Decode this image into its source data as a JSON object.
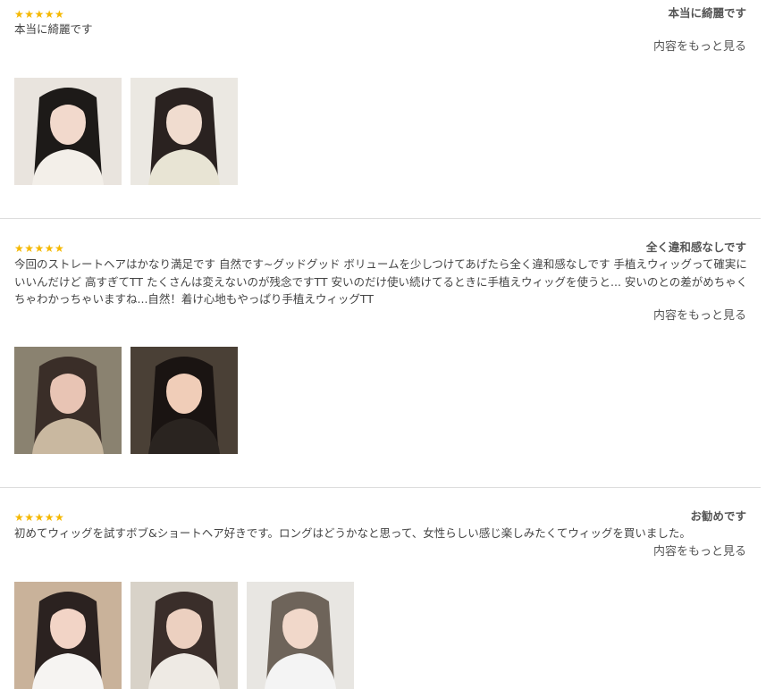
{
  "reviews": [
    {
      "stars": "★★★★★",
      "title": "本当に綺麗です",
      "body": "本当に綺麗です",
      "more_label": "内容をもっと見る",
      "photos": [
        {
          "icon": "photo-woman-long-black-hair-mirror",
          "bg": "#e9e4de",
          "hair": "#1d1a18",
          "cloth": "#f3efe9",
          "skin": "#f2d9cc"
        },
        {
          "icon": "photo-woman-cream-jacket",
          "bg": "#ebe8e2",
          "hair": "#2a2220",
          "cloth": "#e8e4d4",
          "skin": "#f0dccf"
        }
      ]
    },
    {
      "stars": "★★★★★",
      "title": "全く違和感なしです",
      "body": "今回のストレートヘアはかなり満足です 自然です~グッドグッド ボリュームを少しつけてあげたら全く違和感なしです 手植えウィッグって確実にいいんだけど 高すぎてTT たくさんは変えないのが残念ですTT 安いのだけ使い続けてるときに手植えウィッグを使うと... 安いのとの差がめちゃくちゃわかっちゃいますね...自然！着け心地もやっぱり手植えウィッグTT",
      "more_label": "内容をもっと見る",
      "photos": [
        {
          "icon": "photo-person-lying-short-hair",
          "bg": "#8a8270",
          "hair": "#3a2e28",
          "cloth": "#c9b8a0",
          "skin": "#e8c4b4"
        },
        {
          "icon": "photo-woman-long-hair-dark-room",
          "bg": "#4a4036",
          "hair": "#1a1412",
          "cloth": "#2a2420",
          "skin": "#f0cdb8"
        }
      ]
    },
    {
      "stars": "★★★★★",
      "title": "お勧めです",
      "body": "初めてウィッグを試すボブ&ショートヘア好きです。ロングはどうかなと思って、女性らしい感じ楽しみたくてウィッグを買いました。",
      "more_label": "内容をもっと見る",
      "photos": [
        {
          "icon": "photo-woman-bob-guitar",
          "bg": "#c9b29a",
          "hair": "#2b2220",
          "cloth": "#f6f4f2",
          "skin": "#f2d4c6"
        },
        {
          "icon": "photo-woman-room-plants",
          "bg": "#d8d2c8",
          "hair": "#3a2e2a",
          "cloth": "#eeeae4",
          "skin": "#ecd0c0"
        },
        {
          "icon": "photo-woman-long-ash-hair",
          "bg": "#e8e6e2",
          "hair": "#6e645a",
          "cloth": "#f4f4f4",
          "skin": "#f1d8ca"
        }
      ]
    }
  ]
}
